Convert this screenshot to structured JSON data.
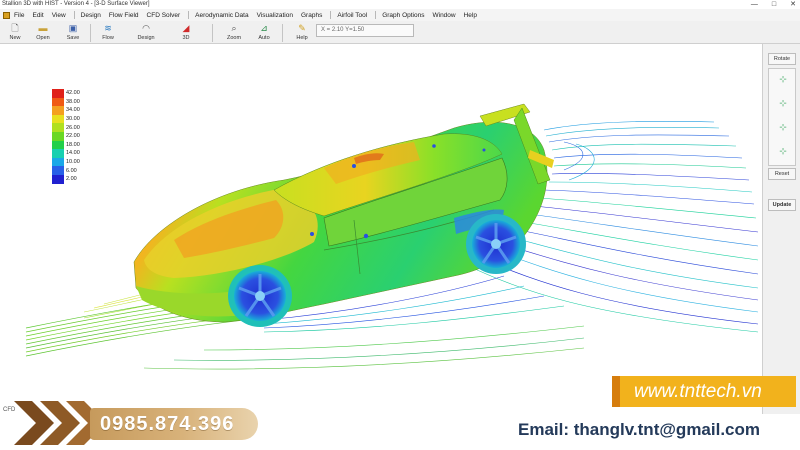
{
  "window": {
    "title": "Stallion 3D with HIST - Version 4 - [3-D Surface Viewer]",
    "controls": [
      "—",
      "□",
      "✕"
    ]
  },
  "menu": {
    "groups": [
      [
        "File",
        "Edit",
        "View"
      ],
      [
        "Design",
        "Flow Field",
        "CFD Solver"
      ],
      [
        "Aerodynamic Data",
        "Visualization",
        "Graphs"
      ],
      [
        "Airfoil Tool"
      ],
      [
        "Graph Options",
        "Window",
        "Help"
      ]
    ]
  },
  "toolbar": {
    "new": "New",
    "open": "Open",
    "save": "Save",
    "flow": "Flow",
    "design": "Design",
    "three_d": "3D",
    "zoom": "Zoom",
    "auto": "Auto",
    "help": "Help",
    "coords": "X = 2.10  Y=1.50",
    "icons": {
      "new": "new-file-icon",
      "open": "folder-icon",
      "save": "floppy-icon",
      "flow": "flow-icon",
      "design": "design-icon",
      "three_d": "3d-icon",
      "zoom": "magnifier-icon",
      "auto": "chart-icon",
      "help": "pointer-icon"
    }
  },
  "right_panel": {
    "rotate": "Rotate",
    "reset": "Reset",
    "update": "Update"
  },
  "legend": {
    "values": [
      "42.00",
      "38.00",
      "34.00",
      "30.00",
      "26.00",
      "22.00",
      "18.00",
      "14.00",
      "10.00",
      "6.00",
      "2.00"
    ],
    "colors": [
      "#e0211a",
      "#f05a14",
      "#f4a020",
      "#e8e020",
      "#b0e020",
      "#6ad824",
      "#22d04a",
      "#18d0b0",
      "#1aa8e8",
      "#2860e8",
      "#2020d0"
    ]
  },
  "status": {
    "text": "CFD"
  },
  "contact": {
    "phone": "0985.874.396",
    "website": "www.tnttech.vn",
    "email": "Email: thanglv.tnt@gmail.com"
  },
  "colors": {
    "phone_pill": "#d0a86c",
    "web_pill": "#f2b21c",
    "email_text": "#243a5a",
    "chevron": "#7a4a1e"
  }
}
